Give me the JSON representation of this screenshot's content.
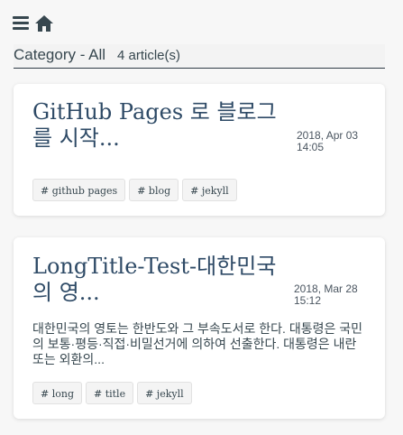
{
  "topbar": {
    "menu_icon": "menu-icon",
    "home_icon": "home-icon"
  },
  "category": {
    "title": "Category - All",
    "count": "4 article(s)"
  },
  "posts": [
    {
      "title": "GitHub Pages 로 블로그를 시작...",
      "date": "2018, Apr 03\n14:05",
      "excerpt": "",
      "tags": [
        "# github pages",
        "# blog",
        "# jekyll"
      ]
    },
    {
      "title": "LongTitle-Test-대한민국의 영...",
      "date": "2018, Mar 28\n15:12",
      "excerpt": "대한민국의 영토는 한반도와 그 부속도서로 한다. 대통령은 국민의 보통·평등·직접·비밀선거에 의하여 선출한다. 대통령은 내란 또는 외환의...",
      "tags": [
        "# long",
        "# title",
        "# jekyll"
      ]
    }
  ],
  "colors": {
    "background": "#f7f7f7",
    "card": "#ffffff",
    "title": "#2e4a66",
    "text": "#37474f"
  }
}
